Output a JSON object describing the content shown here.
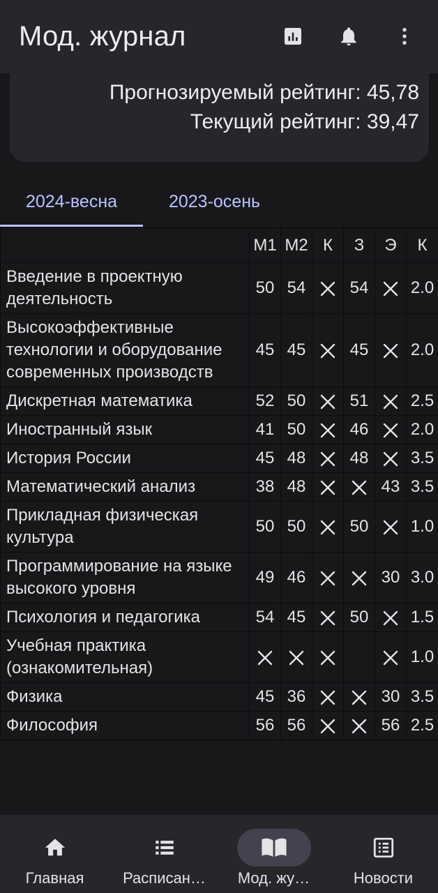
{
  "appbar": {
    "title": "Мод. журнал",
    "actions": [
      {
        "icon": "bar-chart-icon"
      },
      {
        "icon": "bell-icon"
      },
      {
        "icon": "more-vert-icon"
      }
    ]
  },
  "rating_card": {
    "forecast": "Прогнозируемый рейтинг: 45,78",
    "current": "Текущий рейтинг: 39,47"
  },
  "tabs": [
    {
      "label": "2024-весна",
      "active": true
    },
    {
      "label": "2023-осень",
      "active": false
    }
  ],
  "table": {
    "columns": [
      "",
      "М1",
      "М2",
      "К",
      "З",
      "Э",
      "К"
    ],
    "rows": [
      {
        "subject": "Введение в проектную деятельность",
        "m1": "50",
        "m2": "54",
        "k": "x",
        "z": "54",
        "e": "x",
        "credits": "2.0"
      },
      {
        "subject": "Высокоэффективные технологии и оборудование современных производств",
        "m1": "45",
        "m2": "45",
        "k": "x",
        "z": "45",
        "e": "x",
        "credits": "2.0"
      },
      {
        "subject": "Дискретная математика",
        "m1": "52",
        "m2": "50",
        "k": "x",
        "z": "51",
        "e": "x",
        "credits": "2.5"
      },
      {
        "subject": "Иностранный язык",
        "m1": "41",
        "m2": "50",
        "k": "x",
        "z": "46",
        "e": "x",
        "credits": "2.0"
      },
      {
        "subject": "История России",
        "m1": "45",
        "m2": "48",
        "k": "x",
        "z": "48",
        "e": "x",
        "credits": "3.5"
      },
      {
        "subject": "Математический анализ",
        "m1": "38",
        "m2": "48",
        "k": "x",
        "z": "x",
        "e": "43",
        "credits": "3.5"
      },
      {
        "subject": "Прикладная физическая культура",
        "m1": "50",
        "m2": "50",
        "k": "x",
        "z": "50",
        "e": "x",
        "credits": "1.0"
      },
      {
        "subject": "Программирование на языке высокого уровня",
        "m1": "49",
        "m2": "46",
        "k": "x",
        "z": "x",
        "e": "30",
        "credits": "3.0"
      },
      {
        "subject": "Психология и педагогика",
        "m1": "54",
        "m2": "45",
        "k": "x",
        "z": "50",
        "e": "x",
        "credits": "1.5"
      },
      {
        "subject": "Учебная практика (ознакомительная)",
        "m1": "x",
        "m2": "x",
        "k": "x",
        "z": "",
        "e": "x",
        "credits": "1.0"
      },
      {
        "subject": "Физика",
        "m1": "45",
        "m2": "36",
        "k": "x",
        "z": "x",
        "e": "30",
        "credits": "3.5"
      },
      {
        "subject": "Философия",
        "m1": "56",
        "m2": "56",
        "k": "x",
        "z": "x",
        "e": "56",
        "credits": "2.5"
      }
    ]
  },
  "bottom_nav": [
    {
      "label": "Главная",
      "icon": "home-icon",
      "active": false
    },
    {
      "label": "Расписан…",
      "icon": "list-icon",
      "active": false
    },
    {
      "label": "Мод. жу…",
      "icon": "book-icon",
      "active": true
    },
    {
      "label": "Новости",
      "icon": "news-icon",
      "active": false
    }
  ],
  "colors": {
    "background": "#18181b",
    "surface": "#27272b",
    "accent": "#b9c3ff",
    "active_pill": "#42434e"
  }
}
